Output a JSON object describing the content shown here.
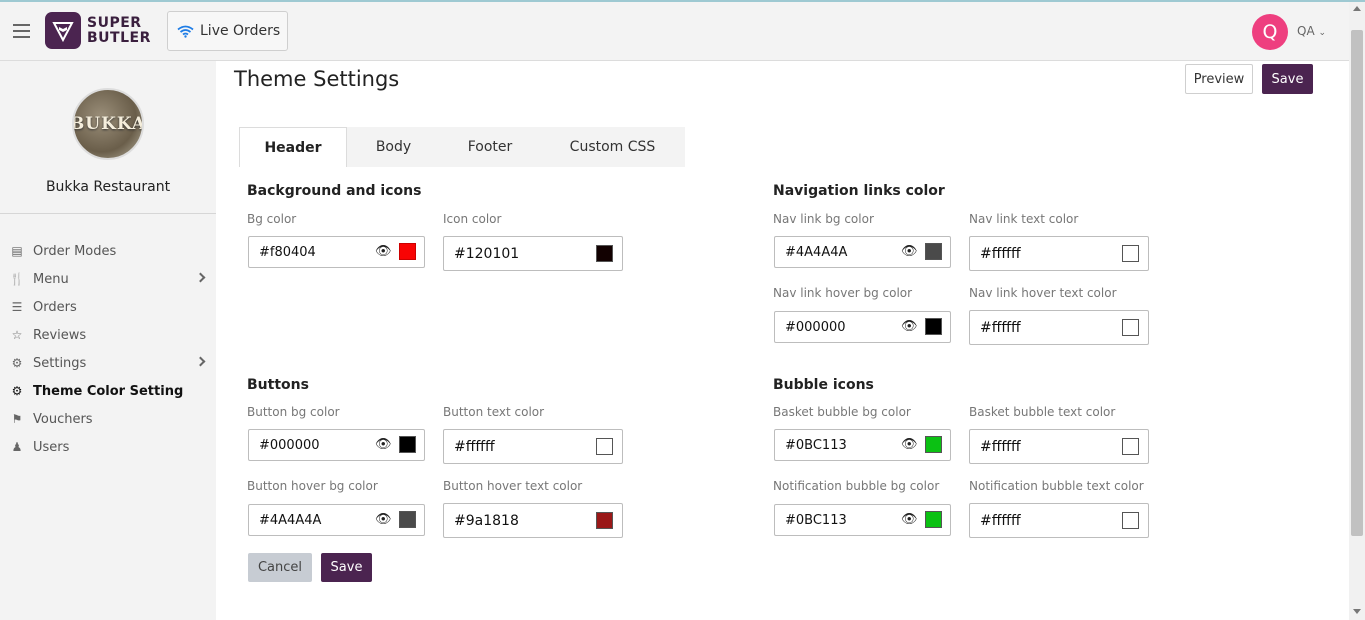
{
  "header": {
    "logo_line1": "SUPER",
    "logo_line2": "BUTLER",
    "live_orders_label": "Live Orders",
    "avatar_initial": "Q",
    "user_label": "QA"
  },
  "sidebar": {
    "restaurant_name": "Bukka Restaurant",
    "restaurant_logo_text": "BUKKA",
    "items": [
      {
        "label": "Order Modes",
        "icon": "order-modes-icon"
      },
      {
        "label": "Menu",
        "icon": "menu-utensils-icon",
        "has_submenu": true
      },
      {
        "label": "Orders",
        "icon": "orders-list-icon"
      },
      {
        "label": "Reviews",
        "icon": "reviews-star-icon"
      },
      {
        "label": "Settings",
        "icon": "gear-icon",
        "has_submenu": true
      },
      {
        "label": "Theme Color Setting",
        "icon": "gear-icon",
        "active": true
      },
      {
        "label": "Vouchers",
        "icon": "tag-icon"
      },
      {
        "label": "Users",
        "icon": "user-icon"
      }
    ]
  },
  "main": {
    "title": "Theme Settings",
    "preview_label": "Preview",
    "save_label": "Save",
    "tabs": [
      {
        "label": "Header",
        "active": true
      },
      {
        "label": "Body"
      },
      {
        "label": "Footer"
      },
      {
        "label": "Custom CSS"
      }
    ],
    "sections": {
      "background": {
        "title": "Background and icons",
        "bg_color": {
          "label": "Bg color",
          "value": "#f80404",
          "swatch": "#f80404"
        },
        "icon_color": {
          "label": "Icon color",
          "value": "#120101",
          "swatch": "#120101"
        }
      },
      "navigation": {
        "title": "Navigation links color",
        "nav_bg": {
          "label": "Nav link bg color",
          "value": "#4A4A4A",
          "swatch": "#4A4A4A"
        },
        "nav_text": {
          "label": "Nav link text color",
          "value": "#ffffff",
          "swatch": "#ffffff"
        },
        "nav_hover_bg": {
          "label": "Nav link hover bg color",
          "value": "#000000",
          "swatch": "#000000"
        },
        "nav_hover_text": {
          "label": "Nav link hover text color",
          "value": "#ffffff",
          "swatch": "#ffffff"
        }
      },
      "buttons": {
        "title": "Buttons",
        "btn_bg": {
          "label": "Button bg color",
          "value": "#000000",
          "swatch": "#000000"
        },
        "btn_text": {
          "label": "Button text color",
          "value": "#ffffff",
          "swatch": "#ffffff"
        },
        "btn_hover_bg": {
          "label": "Button hover bg color",
          "value": "#4A4A4A",
          "swatch": "#4A4A4A"
        },
        "btn_hover_text": {
          "label": "Button hover text color",
          "value": "#9a1818",
          "swatch": "#9a1818"
        }
      },
      "bubble": {
        "title": "Bubble icons",
        "basket_bg": {
          "label": "Basket bubble bg color",
          "value": "#0BC113",
          "swatch": "#0BC113"
        },
        "basket_text": {
          "label": "Basket bubble text color",
          "value": "#ffffff",
          "swatch": "#ffffff"
        },
        "notif_bg": {
          "label": "Notification bubble bg color",
          "value": "#0BC113",
          "swatch": "#0BC113"
        },
        "notif_text": {
          "label": "Notification bubble text color",
          "value": "#ffffff",
          "swatch": "#ffffff"
        }
      }
    },
    "cancel_label": "Cancel",
    "save_bottom_label": "Save"
  },
  "colors": {
    "brand": "#4b2450",
    "avatar": "#ee3f7f"
  }
}
